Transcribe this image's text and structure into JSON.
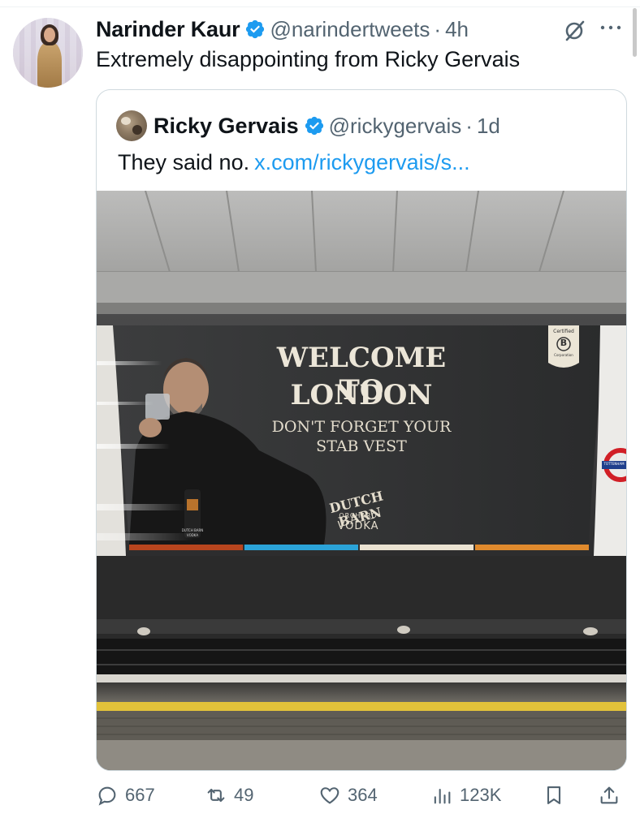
{
  "tweet": {
    "author_name": "Narinder Kaur",
    "handle": "@narindertweets",
    "separator": "·",
    "time": "4h",
    "text": "Extremely disappointing from Ricky Gervais"
  },
  "quoted": {
    "author_name": "Ricky Gervais",
    "handle": "@rickygervais",
    "separator": "·",
    "time": "1d",
    "text": "They said no.",
    "link": "x.com/rickygervais/s..."
  },
  "photo": {
    "headline_line1": "WELCOME TO",
    "headline_line2": "LONDON",
    "sub_line1": "DON'T FORGET YOUR",
    "sub_line2": "STAB VEST",
    "brand": "DUTCH BARN",
    "brand_small": "ORCHARD",
    "brand_product": "VODKA",
    "certified_text": "Certified",
    "b_mark": "B",
    "corporation_text": "Corporation",
    "bottle_label": "DUTCH BARN",
    "bottle_product": "VODKA",
    "roundel_text": "TOTTENHAM"
  },
  "actions": {
    "replies": "667",
    "reposts": "49",
    "likes": "364",
    "views": "123K"
  },
  "icons": [
    "verified-badge-icon",
    "grok-icon",
    "more-icon",
    "reply-icon",
    "repost-icon",
    "like-icon",
    "views-icon",
    "bookmark-icon",
    "share-icon"
  ],
  "colors": {
    "accent": "#1d9bf0",
    "muted": "#536471",
    "text": "#0f1419",
    "border": "#cfd9de"
  }
}
